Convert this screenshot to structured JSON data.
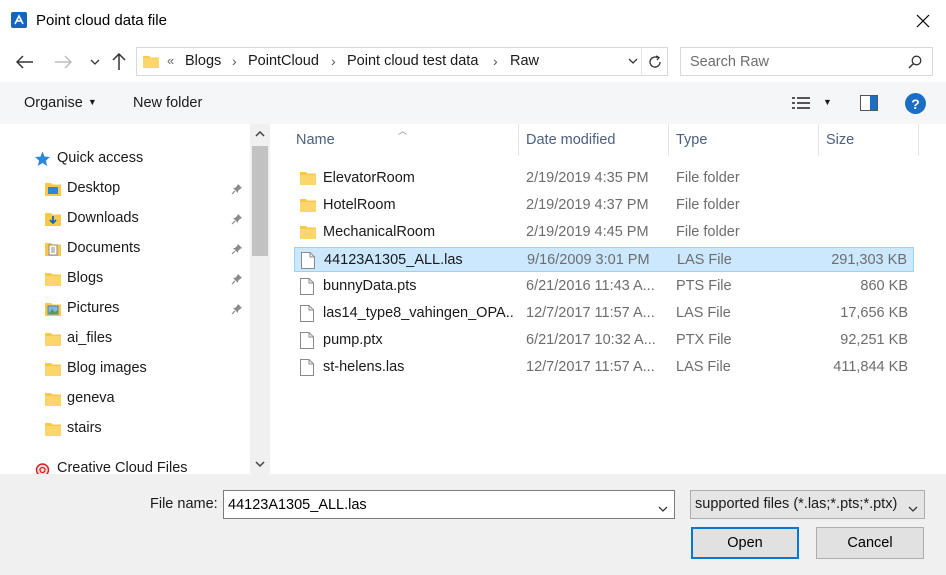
{
  "window": {
    "title": "Point cloud data file",
    "close_glyph": "✕"
  },
  "address": {
    "overflow": "«",
    "crumbs": [
      "Blogs",
      "PointCloud",
      "Point cloud test data",
      "Raw"
    ],
    "separator": "›"
  },
  "search": {
    "placeholder": "Search Raw"
  },
  "toolbar": {
    "organise": "Organise",
    "new_folder": "New folder",
    "help": "?"
  },
  "nav": {
    "items": [
      {
        "label": "Quick access",
        "icon": "star-icon"
      },
      {
        "label": "Desktop",
        "icon": "desktop-folder-icon",
        "pinned": true
      },
      {
        "label": "Downloads",
        "icon": "downloads-folder-icon",
        "pinned": true
      },
      {
        "label": "Documents",
        "icon": "documents-folder-icon",
        "pinned": true
      },
      {
        "label": "Blogs",
        "icon": "folder-icon",
        "pinned": true
      },
      {
        "label": "Pictures",
        "icon": "pictures-folder-icon",
        "pinned": true
      },
      {
        "label": "ai_files",
        "icon": "folder-icon"
      },
      {
        "label": "Blog images",
        "icon": "folder-icon"
      },
      {
        "label": "geneva",
        "icon": "folder-icon"
      },
      {
        "label": "stairs",
        "icon": "folder-icon"
      },
      {
        "label": "Creative Cloud Files",
        "icon": "creative-cloud-icon"
      }
    ]
  },
  "columns": {
    "name": "Name",
    "date": "Date modified",
    "type": "Type",
    "size": "Size"
  },
  "files": [
    {
      "name": "ElevatorRoom",
      "date": "2/19/2019 4:35 PM",
      "type": "File folder",
      "size": "",
      "kind": "folder"
    },
    {
      "name": "HotelRoom",
      "date": "2/19/2019 4:37 PM",
      "type": "File folder",
      "size": "",
      "kind": "folder"
    },
    {
      "name": "MechanicalRoom",
      "date": "2/19/2019 4:45 PM",
      "type": "File folder",
      "size": "",
      "kind": "folder"
    },
    {
      "name": "44123A1305_ALL.las",
      "date": "9/16/2009 3:01 PM",
      "type": "LAS File",
      "size": "291,303 KB",
      "kind": "file",
      "selected": true
    },
    {
      "name": "bunnyData.pts",
      "date": "6/21/2016 11:43 A...",
      "type": "PTS File",
      "size": "860 KB",
      "kind": "file"
    },
    {
      "name": "las14_type8_vahingen_OPA...",
      "date": "12/7/2017 11:57 A...",
      "type": "LAS File",
      "size": "17,656 KB",
      "kind": "file"
    },
    {
      "name": "pump.ptx",
      "date": "6/21/2017 10:32 A...",
      "type": "PTX File",
      "size": "92,251 KB",
      "kind": "file"
    },
    {
      "name": "st-helens.las",
      "date": "12/7/2017 11:57 A...",
      "type": "LAS File",
      "size": "411,844 KB",
      "kind": "file"
    }
  ],
  "footer": {
    "filename_label": "File name:",
    "filename_value": "44123A1305_ALL.las",
    "filter": "supported files (*.las;*.pts;*.ptx)",
    "open": "Open",
    "cancel": "Cancel"
  },
  "colors": {
    "accent": "#0078d7",
    "selection_bg": "#cce8ff",
    "folder_yellow": "#f8c84a",
    "header_text": "#4d6082"
  }
}
